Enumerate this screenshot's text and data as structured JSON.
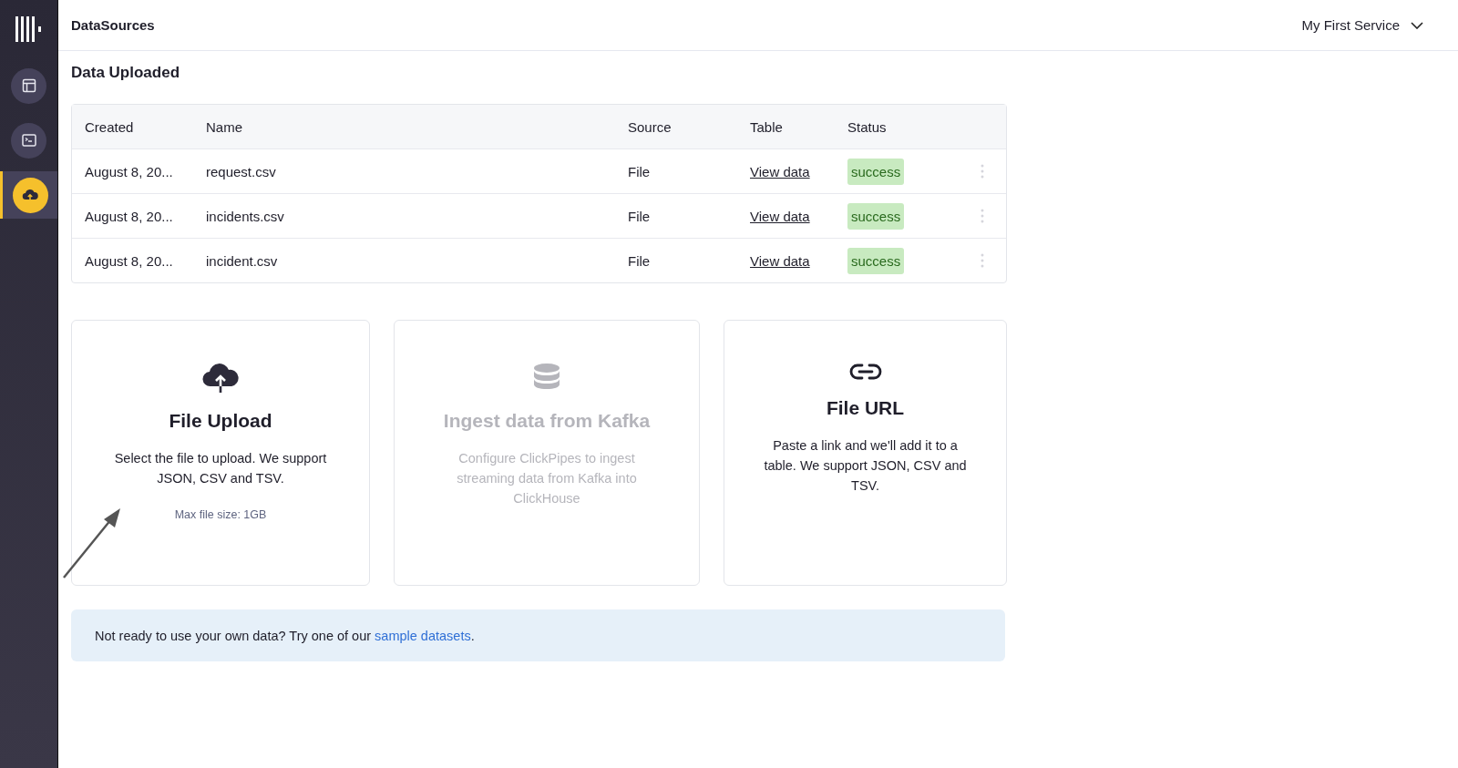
{
  "sidebar": {
    "items": [
      {
        "kind": "layout",
        "selected": false
      },
      {
        "kind": "terminal",
        "selected": false
      },
      {
        "kind": "upload",
        "selected": true
      }
    ]
  },
  "header": {
    "title": "DataSources",
    "service": "My First Service"
  },
  "section_title": "Data Uploaded",
  "table": {
    "columns": [
      "Created",
      "Name",
      "Source",
      "Table",
      "Status"
    ],
    "rows": [
      {
        "created": "August 8, 20...",
        "name": "request.csv",
        "source": "File",
        "table": "View data",
        "status": "success"
      },
      {
        "created": "August 8, 20...",
        "name": "incidents.csv",
        "source": "File",
        "table": "View data",
        "status": "success"
      },
      {
        "created": "August 8, 20...",
        "name": "incident.csv",
        "source": "File",
        "table": "View data",
        "status": "success"
      }
    ]
  },
  "cards": [
    {
      "kind": "upload",
      "title": "File Upload",
      "description": "Select the file to upload. We support JSON, CSV and TSV.",
      "note": "Max file size: 1GB",
      "disabled": false
    },
    {
      "kind": "database",
      "title": "Ingest data from Kafka",
      "description": "Configure ClickPipes to ingest streaming data from Kafka into ClickHouse",
      "disabled": true
    },
    {
      "kind": "link",
      "title": "File URL",
      "description": "Paste a link and we'll add it to a table. We support JSON, CSV and TSV.",
      "disabled": false
    }
  ],
  "banner": {
    "text": "Not ready to use your own data? Try one of our",
    "link": "sample datasets",
    "after": "."
  }
}
